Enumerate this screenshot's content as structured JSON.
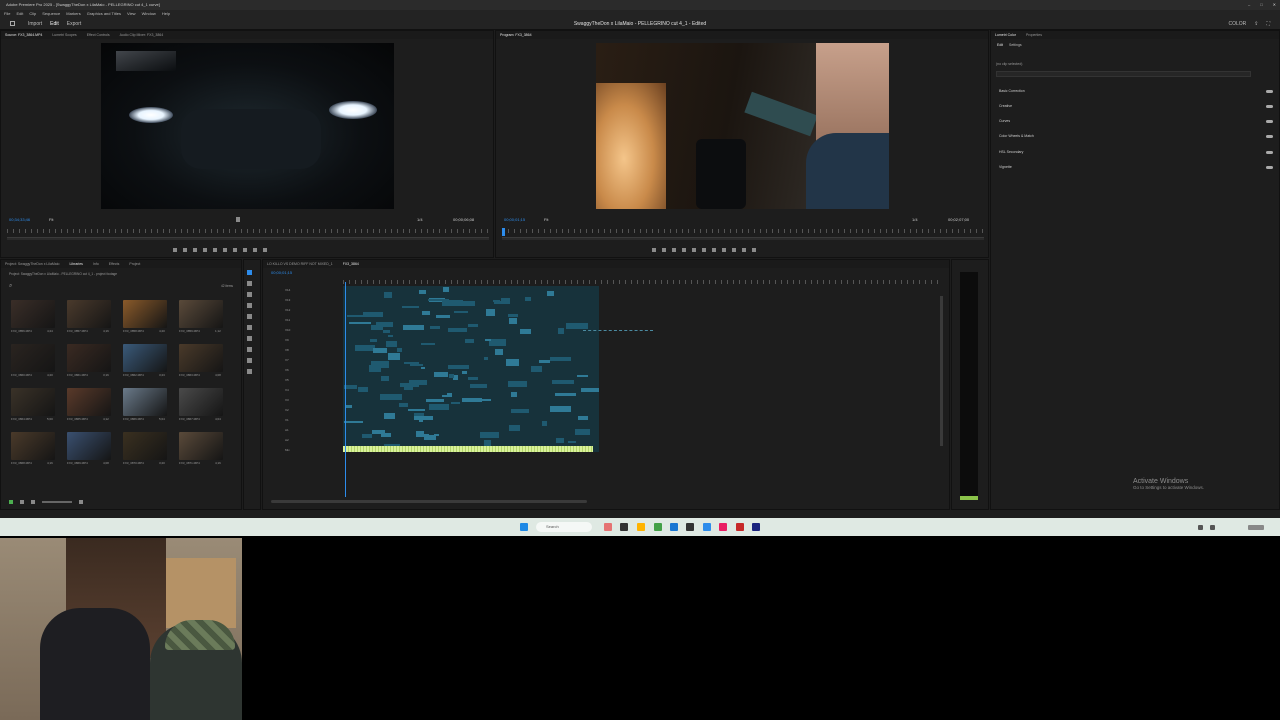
{
  "titlebar": {
    "app_title": "Adobe Premiere Pro 2025 - [SwaggyTheDon x LilaMaio - PELLEGRINO cut 4_1 curve]"
  },
  "menu": {
    "items": [
      "File",
      "Edit",
      "Clip",
      "Sequence",
      "Markers",
      "Graphics and Titles",
      "View",
      "Window",
      "Help"
    ]
  },
  "workspace": {
    "tabs": [
      "Import",
      "Edit",
      "Export"
    ],
    "active_tab": "Edit",
    "center_title": "SwaggyTheDon x LilaMaio - PELLEGRINO cut 4_1 - Edited",
    "right_label": "COLOR"
  },
  "source_monitor": {
    "tabs": [
      "Source: FX3_3864.MP4",
      "Lumetri Scopes",
      "Effect Controls",
      "Audio Clip Mixer: FX3_3864"
    ],
    "timecode_left": "00;34;33;46",
    "fit_label": "Fit",
    "resolution": "1/4",
    "timecode_right": "00;00;06;08"
  },
  "program_monitor": {
    "tabs": [
      "Program: FX3_3864"
    ],
    "timecode_left": "00;00;01;15",
    "fit_label": "Fit",
    "resolution": "1/4",
    "timecode_right": "00;02;07;00"
  },
  "lumetri": {
    "tabs": [
      "Lumetri Color",
      "Properties"
    ],
    "subtabs": [
      "Edit",
      "Settings"
    ],
    "no_clip": "(no clip selected)",
    "sections": [
      "Basic Correction",
      "Creative",
      "Curves",
      "Color Wheels & Match",
      "HSL Secondary",
      "Vignette"
    ]
  },
  "project_panel": {
    "tabs": [
      "Project: SwaggyTheDon x LilaMaio",
      "Libraries",
      "Info",
      "Effects",
      "Project"
    ],
    "path": "Project: SwaggyTheDon x LilaMaio - PELLEGRINO cut 4_1 - project footage",
    "item_count": "42 items",
    "clips": [
      {
        "name": "FX3_3856.MP4",
        "dur": "4;24"
      },
      {
        "name": "FX3_3857.MP4",
        "dur": "4;16"
      },
      {
        "name": "FX3_3858.MP4",
        "dur": "4;20"
      },
      {
        "name": "FX3_3859.MP4",
        "dur": "1;12"
      },
      {
        "name": "FX3_3860.MP4",
        "dur": "4;20"
      },
      {
        "name": "FX3_3861.MP4",
        "dur": "3;16"
      },
      {
        "name": "FX3_3862.MP4",
        "dur": "3;23"
      },
      {
        "name": "FX3_3863.MP4",
        "dur": "4;08"
      },
      {
        "name": "FX3_3864.MP4",
        "dur": "5;00"
      },
      {
        "name": "FX3_3865.MP4",
        "dur": "4;12"
      },
      {
        "name": "FX3_3866.MP4",
        "dur": "5;04"
      },
      {
        "name": "FX3_3867.MP4",
        "dur": "4;04"
      },
      {
        "name": "FX3_3868.MP4",
        "dur": "4;16"
      },
      {
        "name": "FX3_3869.MP4",
        "dur": "4;08"
      },
      {
        "name": "FX3_3870.MP4",
        "dur": "3;20"
      },
      {
        "name": "FX3_3871.MP4",
        "dur": "4;16"
      }
    ]
  },
  "timeline": {
    "tabs": [
      "LO KILLO VS DEMO RIFF NOT MIXED_1",
      "FX3_3864"
    ],
    "timecode": "00;00;01;15",
    "tracks": [
      "V14",
      "V13",
      "V12",
      "V11",
      "V10",
      "V9",
      "V8",
      "V7",
      "V6",
      "V5",
      "V4",
      "V3",
      "V2",
      "V1",
      "A1",
      "A2",
      "Mix"
    ]
  },
  "watermark": {
    "line1": "Activate Windows",
    "line2": "Go to Settings to activate Windows."
  },
  "taskbar": {
    "search": "Search"
  }
}
